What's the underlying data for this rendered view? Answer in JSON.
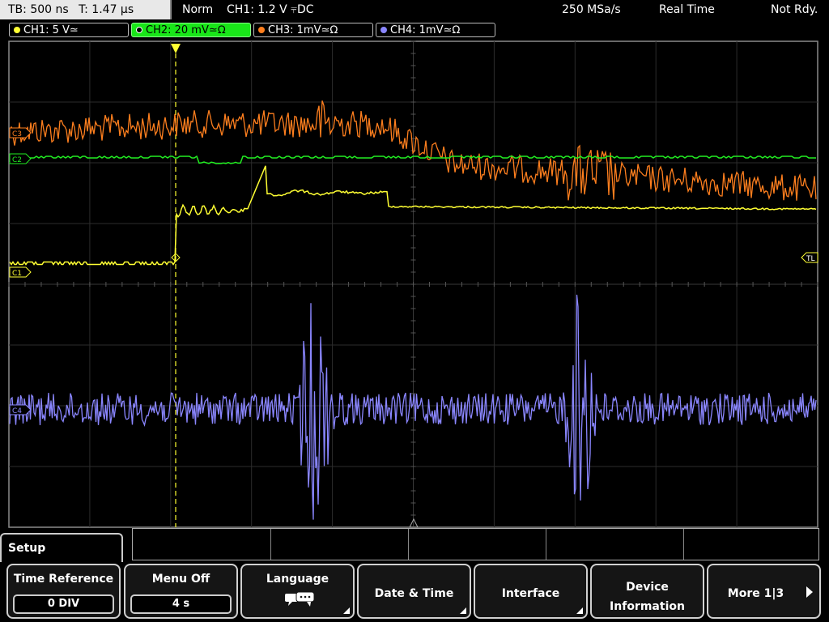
{
  "status": {
    "timebase": "TB: 500 ns",
    "trigger_time": "T: 1.47 µs",
    "mode": "Norm",
    "trigger": "CH1: 1.2 V ⫧DC",
    "sample_rate": "250 MSa/s",
    "acq_mode": "Real Time",
    "state": "Not Rdy."
  },
  "channels": [
    {
      "label": "CH1: 5 V≃",
      "color": "#ffff33"
    },
    {
      "label": "CH2: 20 mV≃Ω",
      "color": "#22ee22"
    },
    {
      "label": "CH3: 1mV≃Ω",
      "color": "#ff7f1e"
    },
    {
      "label": "CH4: 1mV≃Ω",
      "color": "#8a86ff"
    }
  ],
  "markers": {
    "c3": "C3",
    "c2": "C2",
    "c1": "C1",
    "c4": "C4",
    "trigger_level": "TL"
  },
  "menu": {
    "title": "Setup",
    "softkeys": [
      {
        "label": "Time Reference",
        "value": "0 DIV"
      },
      {
        "label": "Menu Off",
        "value": "4 s"
      },
      {
        "label": "Language",
        "icon": "speech-bubble-icon"
      },
      {
        "label": "Date & Time"
      },
      {
        "label": "Interface"
      },
      {
        "label": "Device\nInformation"
      },
      {
        "label": "More 1|3"
      }
    ]
  }
}
